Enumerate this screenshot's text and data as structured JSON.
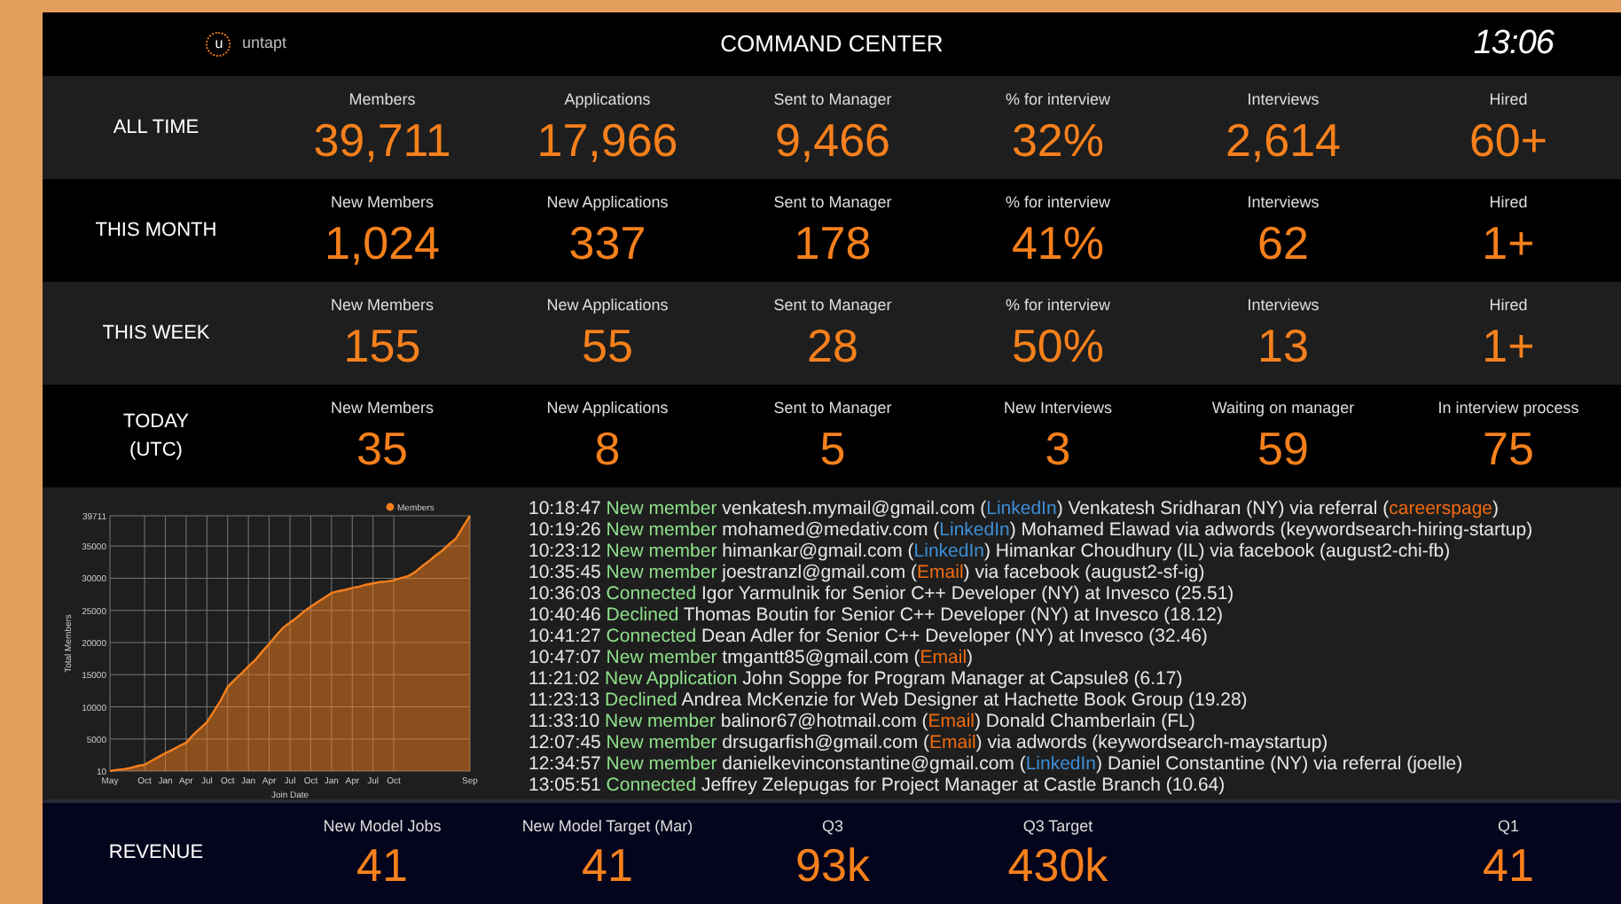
{
  "header": {
    "logo_text": "untapt",
    "logo_letter": "u",
    "title": "COMMAND CENTER",
    "clock": "13:06"
  },
  "stat_rows": [
    {
      "label": "ALL TIME",
      "metrics": [
        {
          "label": "Members",
          "value": "39,711"
        },
        {
          "label": "Applications",
          "value": "17,966"
        },
        {
          "label": "Sent to Manager",
          "value": "9,466"
        },
        {
          "label": "% for interview",
          "value": "32%"
        },
        {
          "label": "Interviews",
          "value": "2,614"
        },
        {
          "label": "Hired",
          "value": "60+"
        }
      ]
    },
    {
      "label": "THIS MONTH",
      "metrics": [
        {
          "label": "New Members",
          "value": "1,024"
        },
        {
          "label": "New Applications",
          "value": "337"
        },
        {
          "label": "Sent to Manager",
          "value": "178"
        },
        {
          "label": "% for interview",
          "value": "41%"
        },
        {
          "label": "Interviews",
          "value": "62"
        },
        {
          "label": "Hired",
          "value": "1+"
        }
      ]
    },
    {
      "label": "THIS WEEK",
      "metrics": [
        {
          "label": "New Members",
          "value": "155"
        },
        {
          "label": "New Applications",
          "value": "55"
        },
        {
          "label": "Sent to Manager",
          "value": "28"
        },
        {
          "label": "% for interview",
          "value": "50%"
        },
        {
          "label": "Interviews",
          "value": "13"
        },
        {
          "label": "Hired",
          "value": "1+"
        }
      ]
    },
    {
      "label": "TODAY",
      "sublabel": "(UTC)",
      "metrics": [
        {
          "label": "New Members",
          "value": "35"
        },
        {
          "label": "New Applications",
          "value": "8"
        },
        {
          "label": "Sent to Manager",
          "value": "5"
        },
        {
          "label": "New Interviews",
          "value": "3"
        },
        {
          "label": "Waiting on manager",
          "value": "59"
        },
        {
          "label": "In interview process",
          "value": "75"
        }
      ]
    }
  ],
  "members_chart": {
    "chart_data": {
      "type": "area",
      "grid": true,
      "xlabel": "Join Date",
      "ylabel": "Total Members",
      "ylim": [
        10,
        39711
      ],
      "yticks": [
        10,
        5000,
        10000,
        15000,
        20000,
        25000,
        30000,
        35000,
        39711
      ],
      "categories": [
        "May",
        null,
        null,
        null,
        null,
        "Oct",
        null,
        null,
        "Jan",
        null,
        null,
        "Apr",
        null,
        null,
        "Jul",
        null,
        null,
        "Oct",
        null,
        null,
        "Jan",
        null,
        null,
        "Apr",
        null,
        null,
        "Jul",
        null,
        null,
        "Oct",
        null,
        null,
        "Jan",
        null,
        null,
        "Apr",
        null,
        null,
        "Jul",
        null,
        null,
        "Oct",
        null,
        null,
        null,
        null,
        null,
        null,
        null,
        null,
        null,
        null,
        "Sep"
      ],
      "series": [
        {
          "name": "Members",
          "color": "#f7801c",
          "values": [
            10,
            200,
            300,
            500,
            800,
            1000,
            1600,
            2200,
            2800,
            3300,
            3900,
            4400,
            5600,
            6600,
            7600,
            9300,
            11000,
            13100,
            14200,
            15200,
            16300,
            17300,
            18600,
            19800,
            21100,
            22300,
            23100,
            23900,
            24800,
            25600,
            26300,
            27000,
            27700,
            28000,
            28200,
            28500,
            28700,
            29000,
            29200,
            29400,
            29500,
            29700,
            30000,
            30300,
            30900,
            31800,
            32600,
            33500,
            34300,
            35300,
            36200,
            38000,
            39700
          ]
        }
      ]
    }
  },
  "activity_log": [
    {
      "time": "10:18:47",
      "event": "New member",
      "parts": [
        {
          "kind": "plain",
          "text": "venkatesh.mymail@gmail.com ("
        },
        {
          "kind": "linkedin",
          "text": "LinkedIn"
        },
        {
          "kind": "plain",
          "text": ") Venkatesh Sridharan (NY) via referral ("
        },
        {
          "kind": "email",
          "text": "careerspage"
        },
        {
          "kind": "plain",
          "text": ")"
        }
      ]
    },
    {
      "time": "10:19:26",
      "event": "New member",
      "parts": [
        {
          "kind": "plain",
          "text": "mohamed@medativ.com ("
        },
        {
          "kind": "linkedin",
          "text": "LinkedIn"
        },
        {
          "kind": "plain",
          "text": ") Mohamed Elawad via adwords (keywordsearch-hiring-startup)"
        }
      ]
    },
    {
      "time": "10:23:12",
      "event": "New member",
      "parts": [
        {
          "kind": "plain",
          "text": "himankar@gmail.com ("
        },
        {
          "kind": "linkedin",
          "text": "LinkedIn"
        },
        {
          "kind": "plain",
          "text": ") Himankar Choudhury (IL) via facebook (august2-chi-fb)"
        }
      ]
    },
    {
      "time": "10:35:45",
      "event": "New member",
      "parts": [
        {
          "kind": "plain",
          "text": "joestranzl@gmail.com ("
        },
        {
          "kind": "email",
          "text": "Email"
        },
        {
          "kind": "plain",
          "text": ") via facebook (august2-sf-ig)"
        }
      ]
    },
    {
      "time": "10:36:03",
      "event": "Connected",
      "parts": [
        {
          "kind": "plain",
          "text": "Igor Yarmulnik for Senior C++ Developer (NY) at Invesco (25.51)"
        }
      ]
    },
    {
      "time": "10:40:46",
      "event": "Declined",
      "parts": [
        {
          "kind": "plain",
          "text": "Thomas Boutin for Senior C++ Developer (NY) at Invesco (18.12)"
        }
      ]
    },
    {
      "time": "10:41:27",
      "event": "Connected",
      "parts": [
        {
          "kind": "plain",
          "text": "Dean Adler for Senior C++ Developer (NY) at Invesco (32.46)"
        }
      ]
    },
    {
      "time": "10:47:07",
      "event": "New member",
      "parts": [
        {
          "kind": "plain",
          "text": "tmgantt85@gmail.com ("
        },
        {
          "kind": "email",
          "text": "Email"
        },
        {
          "kind": "plain",
          "text": ")"
        }
      ]
    },
    {
      "time": "11:21:02",
      "event": "New Application",
      "parts": [
        {
          "kind": "plain",
          "text": "John Soppe for Program Manager at Capsule8 (6.17)"
        }
      ]
    },
    {
      "time": "11:23:13",
      "event": "Declined",
      "parts": [
        {
          "kind": "plain",
          "text": "Andrea McKenzie for Web Designer at Hachette Book Group (19.28)"
        }
      ]
    },
    {
      "time": "11:33:10",
      "event": "New member",
      "parts": [
        {
          "kind": "plain",
          "text": "balinor67@hotmail.com ("
        },
        {
          "kind": "email",
          "text": "Email"
        },
        {
          "kind": "plain",
          "text": ") Donald Chamberlain (FL)"
        }
      ]
    },
    {
      "time": "12:07:45",
      "event": "New member",
      "parts": [
        {
          "kind": "plain",
          "text": "drsugarfish@gmail.com ("
        },
        {
          "kind": "email",
          "text": "Email"
        },
        {
          "kind": "plain",
          "text": ") via adwords (keywordsearch-maystartup)"
        }
      ]
    },
    {
      "time": "12:34:57",
      "event": "New member",
      "parts": [
        {
          "kind": "plain",
          "text": "danielkevinconstantine@gmail.com ("
        },
        {
          "kind": "linkedin",
          "text": "LinkedIn"
        },
        {
          "kind": "plain",
          "text": ") Daniel Constantine (NY) via referral (joelle)"
        }
      ]
    },
    {
      "time": "13:05:51",
      "event": "Connected",
      "parts": [
        {
          "kind": "plain",
          "text": "Jeffrey Zelepugas for Project Manager at Castle Branch (10.64)"
        }
      ]
    }
  ],
  "revenue": {
    "label": "REVENUE",
    "metrics": [
      {
        "label": "New Model Jobs",
        "value": "41"
      },
      {
        "label": "New Model Target (Mar)",
        "value": "41"
      },
      {
        "label": "Q3",
        "value": "93k"
      },
      {
        "label": "Q3 Target",
        "value": "430k"
      },
      {
        "label": "Q1",
        "value": "41"
      }
    ]
  }
}
